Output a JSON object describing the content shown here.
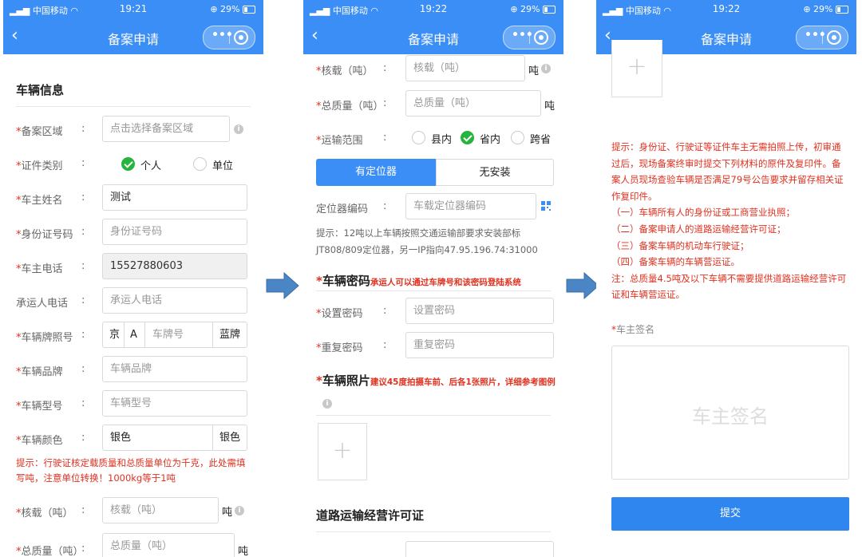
{
  "status_bar": {
    "carrier": "中国移动",
    "times": [
      "19:21",
      "19:22",
      "19:22"
    ],
    "battery": "29%"
  },
  "nav": {
    "title": "备案申请",
    "back": "‹",
    "more": "•••"
  },
  "screen1": {
    "section_title": "车辆信息",
    "fields": {
      "area": {
        "label": "备案区域",
        "placeholder": "点击选择备案区域"
      },
      "cert_type": {
        "label": "证件类别",
        "option_personal": "个人",
        "option_unit": "单位"
      },
      "owner_name": {
        "label": "车主姓名",
        "value": "测试"
      },
      "id_number": {
        "label": "身份证号码",
        "placeholder": "身份证号码"
      },
      "owner_phone": {
        "label": "车主电话",
        "value": "15527880603"
      },
      "carrier_phone": {
        "label": "承运人电话",
        "placeholder": "承运人电话"
      },
      "plate": {
        "label": "车辆牌照号",
        "province": "京",
        "letter": "A",
        "placeholder": "车牌号",
        "color": "蓝牌"
      },
      "brand": {
        "label": "车辆品牌",
        "placeholder": "车辆品牌"
      },
      "model": {
        "label": "车辆型号",
        "placeholder": "车辆型号"
      },
      "color": {
        "label": "车辆颜色",
        "value": "银色",
        "suffix": "银色"
      },
      "load": {
        "label": "核载（吨）",
        "placeholder": "核载（吨）",
        "unit": "吨"
      },
      "total": {
        "label": "总质量（吨）",
        "placeholder": "总质量（吨）",
        "unit": "吨"
      }
    },
    "tip_line1": "提示：行驶证核定载质量和总质量单位为千克，此处需填",
    "tip_line2": "写吨，注意单位转换！1000kg等于1吨"
  },
  "screen2": {
    "load": {
      "label": "核载（吨）",
      "placeholder": "核载（吨）",
      "unit": "吨"
    },
    "total": {
      "label": "总质量（吨）",
      "placeholder": "总质量（吨）",
      "unit": "吨"
    },
    "scope": {
      "label": "运输范围",
      "opt1": "县内",
      "opt2": "省内",
      "opt3": "跨省"
    },
    "locator_tab_on": "有定位器",
    "locator_tab_off": "无安装",
    "locator": {
      "label": "定位器编码",
      "placeholder": "车载定位器编码"
    },
    "locator_tip_line1": "提示：12吨以上车辆按照交通运输部要求安装部标",
    "locator_tip_line2": "JT808/809定位器，另一IP指向47.95.196.74:31000",
    "password_title": "车辆密码",
    "password_hint": "承运人可以通过车牌号和该密码登陆系统",
    "set_pwd": {
      "label": "设置密码",
      "placeholder": "设置密码"
    },
    "repeat_pwd": {
      "label": "重复密码",
      "placeholder": "重复密码"
    },
    "photo_title": "车辆照片",
    "photo_hint": "建议45度拍摄车前、后各1张照片，详细参考图例",
    "plus": "+",
    "road_title": "道路运输经营许可证"
  },
  "screen3": {
    "plus": "+",
    "tip_lines": [
      "提示：身份证、行驶证等证件车主无需拍照上传，初审通",
      "过后，现场备案终审时提交下列材料的原件及复印件。备",
      "案人员现场查验车辆是否满足79号公告要求并留存相关证",
      "作复印件。",
      "（一）车辆所有人的身份证或工商营业执照；",
      "（二）备案申请人的道路运输经营许可证；",
      "（三）备案车辆的机动车行驶证；",
      "（四）备案车辆的车辆营运证。",
      "注：总质量4.5吨及以下车辆不需要提供道路运输经营许可",
      "证和车辆营运证。"
    ],
    "sign_label": "车主签名",
    "sign_placeholder": "车主签名",
    "submit": "提交"
  },
  "colors": {
    "primary": "#3a8ef5",
    "required": "#e0311f",
    "check": "#26b33e",
    "arrow": "#4a86c5"
  }
}
